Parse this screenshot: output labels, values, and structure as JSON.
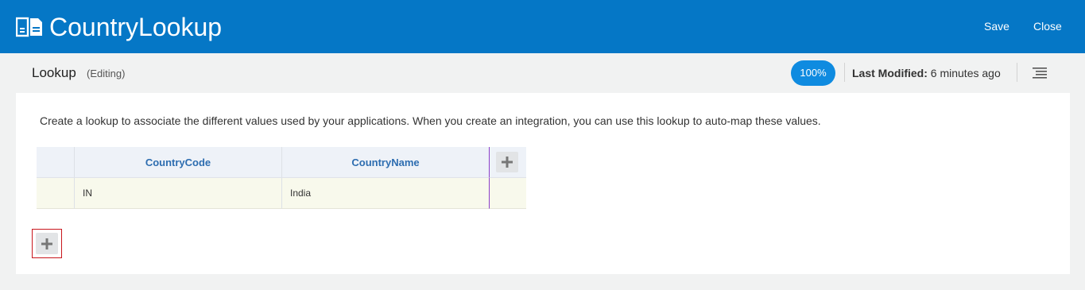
{
  "header": {
    "app_title": "CountryLookup",
    "app_icon": "lookup-document-icon",
    "save_label": "Save",
    "close_label": "Close",
    "brand_color": "#0577c6"
  },
  "subbar": {
    "title": "Lookup",
    "state": "(Editing)",
    "progress": "100%",
    "last_modified_label": "Last Modified:",
    "last_modified_value": "6 minutes ago",
    "menu_icon": "list-menu-icon"
  },
  "main": {
    "description": "Create a lookup to associate the different values used by your applications. When you create an integration, you can use this lookup to auto-map these values.",
    "table": {
      "columns": [
        "CountryCode",
        "CountryName"
      ],
      "rows": [
        [
          "IN",
          "India"
        ]
      ]
    },
    "add_column_icon": "plus-icon",
    "add_row_icon": "plus-icon"
  }
}
